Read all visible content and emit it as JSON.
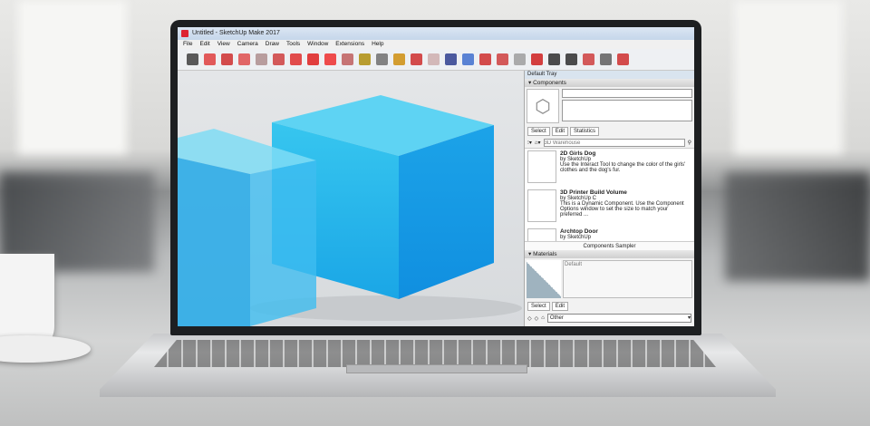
{
  "window": {
    "title": "Untitled - SketchUp Make 2017"
  },
  "menu": [
    "File",
    "Edit",
    "View",
    "Camera",
    "Draw",
    "Tools",
    "Window",
    "Extensions",
    "Help"
  ],
  "tools": [
    "select-icon",
    "eraser-icon",
    "pencil-icon",
    "arc-icon",
    "rectangle-icon",
    "push-pull-icon",
    "follow-me-icon",
    "move-icon",
    "rotate-icon",
    "scale-icon",
    "tape-measure-icon",
    "text-icon",
    "paint-bucket-icon",
    "orbit-icon",
    "pan-icon",
    "zoom-icon",
    "zoom-extents-icon",
    "warehouse-icon",
    "extension-warehouse-icon",
    "layout-icon",
    "share-icon",
    "solid-tools-icon",
    "solid-tools-2-icon",
    "section-plane-icon",
    "box-icon",
    "push-pull-2-icon"
  ],
  "tray": {
    "title": "Default Tray",
    "components": {
      "header": "Components",
      "tabs": [
        "Select",
        "Edit",
        "Statistics"
      ],
      "search_placeholder": "3D Warehouse",
      "items": [
        {
          "title": "2D Girls Dog",
          "author": "by SketchUp",
          "desc": "Use the Interact Tool to change the color of the girls' clothes and the dog's fur."
        },
        {
          "title": "3D Printer Build Volume",
          "author": "by SketchUp C",
          "desc": "This is a Dynamic Component. Use the Component Options window to set the size to match your preferred ..."
        },
        {
          "title": "Archtop Door",
          "author": "by SketchUp",
          "desc": ""
        }
      ],
      "footer": "Components Sampler"
    },
    "materials": {
      "header": "Materials",
      "name": "Default",
      "tabs": [
        "Select",
        "Edit"
      ],
      "collection": "Other"
    }
  }
}
